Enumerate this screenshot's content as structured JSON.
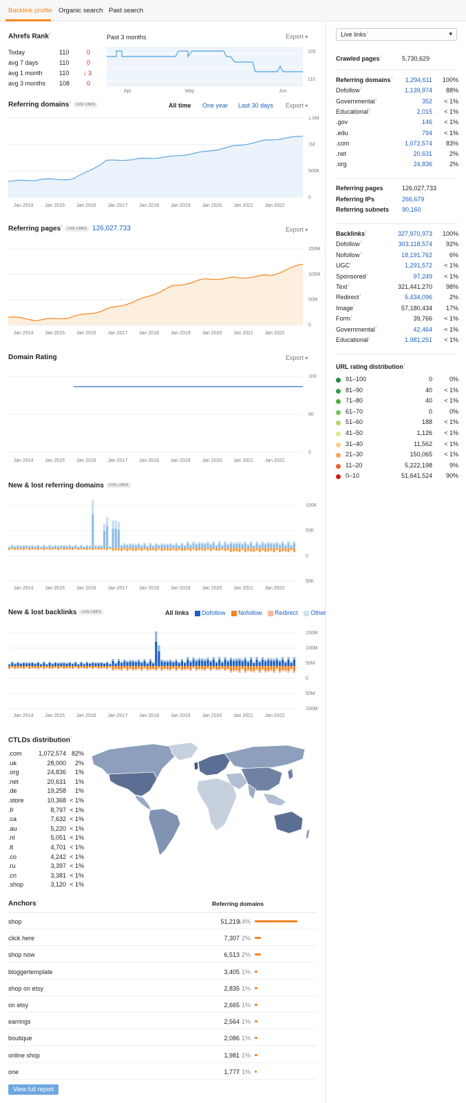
{
  "tabs": [
    {
      "label": "Backlink profile",
      "active": true
    },
    {
      "label": "Organic search",
      "active": false
    },
    {
      "label": "Paid search",
      "active": false
    }
  ],
  "export_label": "Export",
  "live_badge": "LIVE LINKS",
  "ahrefs_rank": {
    "title": "Ahrefs Rank",
    "period": "Past 3 months",
    "rows": [
      {
        "label": "Today",
        "value": "110",
        "change": "0"
      },
      {
        "label": "avg 7 days",
        "value": "110",
        "change": "0"
      },
      {
        "label": "avg 1 month",
        "value": "110",
        "change": "3"
      },
      {
        "label": "avg 3 months",
        "value": "108",
        "change": "0"
      }
    ],
    "chart": {
      "months": [
        "Apr",
        "May",
        "Jun"
      ],
      "y_ticks": [
        "105",
        "110"
      ]
    }
  },
  "referring_domains": {
    "title": "Referring domains",
    "time_tabs": [
      "All time",
      "One year",
      "Last 30 days"
    ],
    "chart_data": {
      "type": "area",
      "x": [
        "Jan 2014",
        "Jan 2015",
        "Jan 2016",
        "Jan 2017",
        "Jan 2018",
        "Jan 2019",
        "Jan 2020",
        "Jan 2021",
        "Jan 2022"
      ],
      "y_ticks": [
        "1.5M",
        "1M",
        "500K",
        "0"
      ],
      "values": [
        330000,
        370000,
        380000,
        760000,
        800000,
        850000,
        950000,
        1080000,
        1200000,
        1270000
      ],
      "color": "#5aa5de"
    }
  },
  "referring_pages": {
    "title": "Referring pages",
    "value": "126,027,733",
    "chart_data": {
      "type": "area",
      "x": [
        "Jan 2014",
        "Jan 2015",
        "Jan 2016",
        "Jan 2017",
        "Jan 2018",
        "Jan 2019",
        "Jan 2020",
        "Jan 2021",
        "Jan 2022"
      ],
      "y_ticks": [
        "150M",
        "100M",
        "50M",
        "0"
      ],
      "values": [
        16000000,
        10000000,
        17000000,
        32000000,
        52000000,
        80000000,
        95000000,
        98000000,
        103000000,
        126000000
      ],
      "color": "#f5841f"
    }
  },
  "domain_rating": {
    "title": "Domain Rating",
    "chart_data": {
      "type": "line",
      "x": [
        "Jan 2014",
        "Jan 2015",
        "Jan 2016",
        "Jan 2017",
        "Jan 2018",
        "Jan 2019",
        "Jan 2020",
        "Jan 2021",
        "Jan 2022"
      ],
      "y_ticks": [
        "100",
        "50",
        "0"
      ],
      "values": [
        92,
        92,
        92,
        92,
        92,
        92,
        92,
        92
      ]
    }
  },
  "new_lost_domains": {
    "title": "New & lost referring domains",
    "chart_data": {
      "type": "bar",
      "x": [
        "Jan 2014",
        "Jan 2015",
        "Jan 2016",
        "Jan 2017",
        "Jan 2018",
        "Jan 2019",
        "Jan 2020",
        "Jan 2021",
        "Jan 2022"
      ],
      "y_ticks": [
        "100K",
        "50K",
        "0",
        "50K"
      ]
    }
  },
  "new_lost_backlinks": {
    "title": "New & lost backlinks",
    "legend_label": "All links",
    "legend": [
      {
        "name": "Dofollow",
        "color": "#1b5fbf"
      },
      {
        "name": "Nofollow",
        "color": "#f5841f"
      },
      {
        "name": "Redirect",
        "color": "#f3b8a0"
      },
      {
        "name": "Other",
        "color": "#d5e1f0"
      }
    ],
    "chart_data": {
      "type": "bar",
      "x": [
        "Jan 2014",
        "Jan 2015",
        "Jan 2016",
        "Jan 2017",
        "Jan 2018",
        "Jan 2019",
        "Jan 2020",
        "Jan 2021",
        "Jan 2022"
      ],
      "y_ticks": [
        "150M",
        "100M",
        "50M",
        "0",
        "50M",
        "100M"
      ]
    }
  },
  "ctlds": {
    "title": "CTLDs distribution",
    "rows": [
      {
        "tld": ".com",
        "value": "1,072,574",
        "pct": "82%"
      },
      {
        "tld": ".uk",
        "value": "28,000",
        "pct": "2%"
      },
      {
        "tld": ".org",
        "value": "24,836",
        "pct": "1%"
      },
      {
        "tld": ".net",
        "value": "20,631",
        "pct": "1%"
      },
      {
        "tld": ".de",
        "value": "19,258",
        "pct": "1%"
      },
      {
        "tld": ".store",
        "value": "10,368",
        "pct": "< 1%"
      },
      {
        "tld": ".fr",
        "value": "8,797",
        "pct": "< 1%"
      },
      {
        "tld": ".ca",
        "value": "7,632",
        "pct": "< 1%"
      },
      {
        "tld": ".au",
        "value": "5,220",
        "pct": "< 1%"
      },
      {
        "tld": ".nl",
        "value": "5,051",
        "pct": "< 1%"
      },
      {
        "tld": ".lt",
        "value": "4,701",
        "pct": "< 1%"
      },
      {
        "tld": ".co",
        "value": "4,242",
        "pct": "< 1%"
      },
      {
        "tld": ".ru",
        "value": "3,397",
        "pct": "< 1%"
      },
      {
        "tld": ".cn",
        "value": "3,381",
        "pct": "< 1%"
      },
      {
        "tld": ".shop",
        "value": "3,120",
        "pct": "< 1%"
      }
    ]
  },
  "anchors": {
    "title": "Anchors",
    "col": "Referring domains",
    "button": "View full report",
    "rows": [
      {
        "text": "shop",
        "value": "51,219",
        "pct": "14%",
        "share": 14
      },
      {
        "text": "click here",
        "value": "7,307",
        "pct": "2%",
        "share": 2
      },
      {
        "text": "shop now",
        "value": "6,513",
        "pct": "2%",
        "share": 2
      },
      {
        "text": "bloggertemplate",
        "value": "3,405",
        "pct": "1%",
        "share": 1
      },
      {
        "text": "shop on etsy",
        "value": "2,835",
        "pct": "1%",
        "share": 1
      },
      {
        "text": "on etsy",
        "value": "2,665",
        "pct": "1%",
        "share": 1
      },
      {
        "text": "earrings",
        "value": "2,564",
        "pct": "1%",
        "share": 1
      },
      {
        "text": "boutique",
        "value": "2,086",
        "pct": "1%",
        "share": 1
      },
      {
        "text": "online shop",
        "value": "1,981",
        "pct": "1%",
        "share": 1
      },
      {
        "text": "one",
        "value": "1,777",
        "pct": "< 1%",
        "share": 0.5
      }
    ]
  },
  "sidebar": {
    "select": "Live links",
    "crawled": {
      "label": "Crawled pages",
      "value": "5,730,629"
    },
    "domains": [
      {
        "label": "Referring domains",
        "value": "1,294,611",
        "pct": "100%",
        "bold": true,
        "info": true
      },
      {
        "label": "Dofollow",
        "value": "1,139,974",
        "pct": "88%",
        "info": true
      },
      {
        "label": "Governmental",
        "value": "352",
        "pct": "< 1%",
        "info": true
      },
      {
        "label": "Educational",
        "value": "2,015",
        "pct": "< 1%",
        "info": true
      },
      {
        "label": ".gov",
        "value": "146",
        "pct": "< 1%"
      },
      {
        "label": ".edu",
        "value": "794",
        "pct": "< 1%"
      },
      {
        "label": ".com",
        "value": "1,072,574",
        "pct": "83%"
      },
      {
        "label": ".net",
        "value": "20,631",
        "pct": "2%"
      },
      {
        "label": ".org",
        "value": "24,836",
        "pct": "2%"
      }
    ],
    "pages": [
      {
        "label": "Referring pages",
        "value": "126,027,733",
        "link": false
      },
      {
        "label": "Referring IPs",
        "value": "266,679",
        "link": true
      },
      {
        "label": "Referring subnets",
        "value": "90,160",
        "link": true
      }
    ],
    "backlinks": [
      {
        "label": "Backlinks",
        "value": "327,970,973",
        "pct": "100%",
        "bold": true,
        "info": true,
        "link": true
      },
      {
        "label": "Dofollow",
        "value": "303,118,574",
        "pct": "92%",
        "info": true,
        "link": true
      },
      {
        "label": "Nofollow",
        "value": "18,191,762",
        "pct": "6%",
        "info": true,
        "link": true
      },
      {
        "label": "UGC",
        "value": "1,291,572",
        "pct": "< 1%",
        "info": true,
        "link": true
      },
      {
        "label": "Sponsored",
        "value": "97,249",
        "pct": "< 1%",
        "info": true,
        "link": true
      },
      {
        "label": "Text",
        "value": "321,441,270",
        "pct": "98%",
        "info": true,
        "link": false
      },
      {
        "label": "Redirect",
        "value": "5,434,096",
        "pct": "2%",
        "info": true,
        "link": true
      },
      {
        "label": "Image",
        "value": "57,180,434",
        "pct": "17%",
        "info": true,
        "link": false
      },
      {
        "label": "Form",
        "value": "39,766",
        "pct": "< 1%",
        "info": true,
        "link": false
      },
      {
        "label": "Governmental",
        "value": "42,464",
        "pct": "< 1%",
        "info": true,
        "link": true
      },
      {
        "label": "Educational",
        "value": "1,981,251",
        "pct": "< 1%",
        "info": true,
        "link": true
      }
    ],
    "url_rating": {
      "title": "URL rating distribution",
      "rows": [
        {
          "range": "91–100",
          "value": "0",
          "pct": "0%",
          "color": "#1e8a3a"
        },
        {
          "range": "81–90",
          "value": "40",
          "pct": "< 1%",
          "color": "#2e9e44"
        },
        {
          "range": "71–80",
          "value": "40",
          "pct": "< 1%",
          "color": "#4cae4c"
        },
        {
          "range": "61–70",
          "value": "0",
          "pct": "0%",
          "color": "#7ac35a"
        },
        {
          "range": "51–60",
          "value": "188",
          "pct": "< 1%",
          "color": "#b2d86a"
        },
        {
          "range": "41–50",
          "value": "1,126",
          "pct": "< 1%",
          "color": "#e5e58a"
        },
        {
          "range": "31–40",
          "value": "11,562",
          "pct": "< 1%",
          "color": "#f5d08a"
        },
        {
          "range": "21–30",
          "value": "150,065",
          "pct": "< 1%",
          "color": "#f3a652"
        },
        {
          "range": "11–20",
          "value": "5,222,198",
          "pct": "9%",
          "color": "#e5632e"
        },
        {
          "range": "0–10",
          "value": "51,641,524",
          "pct": "90%",
          "color": "#c81e1e"
        }
      ]
    }
  }
}
